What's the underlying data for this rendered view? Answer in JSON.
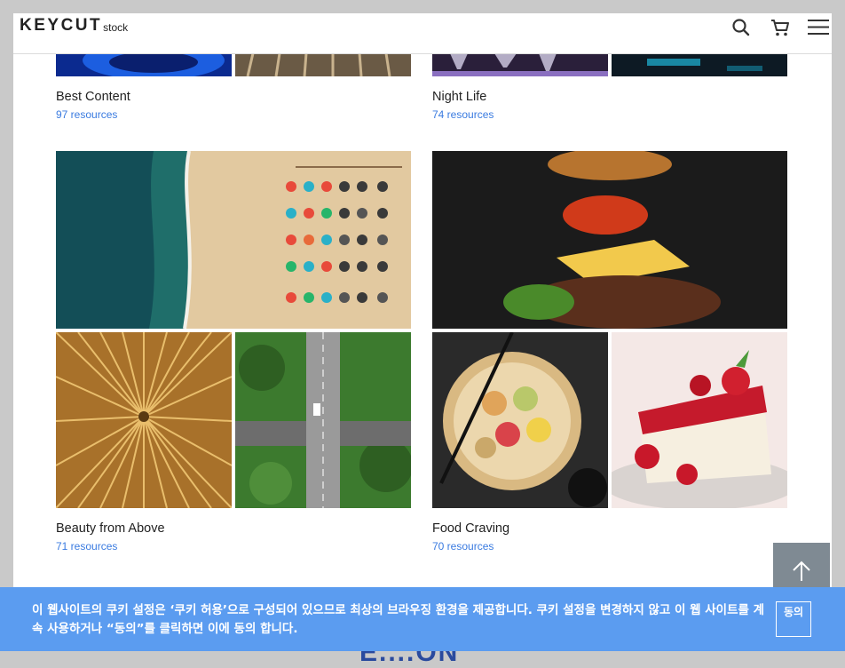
{
  "header": {
    "logo_main": "KEYCUT",
    "logo_sub": "stock",
    "icons": [
      "search-icon",
      "cart-icon",
      "menu-icon"
    ]
  },
  "collections": [
    {
      "title": "Best Content",
      "count": "97 resources"
    },
    {
      "title": "Night Life",
      "count": "74 resources"
    },
    {
      "title": "Beauty from Above",
      "count": "71 resources"
    },
    {
      "title": "Food Craving",
      "count": "70 resources"
    }
  ],
  "cookie": {
    "text": "이 웹사이트의 쿠키 설정은 ‘쿠키 허용’으로 구성되어 있으므로 최상의 브라우징 환경을 제공합니다. 쿠키 설정을 변경하지 않고 이 웹 사이트를 계속 사용하거나 “동의”를 클릭하면 이에 동의 합니다.",
    "agree_label": "동의"
  },
  "footer_peek": "E....ON",
  "colors": {
    "accent": "#3a7be0",
    "banner": "#5b9cf0",
    "back_to_top": "#7f8a93"
  }
}
